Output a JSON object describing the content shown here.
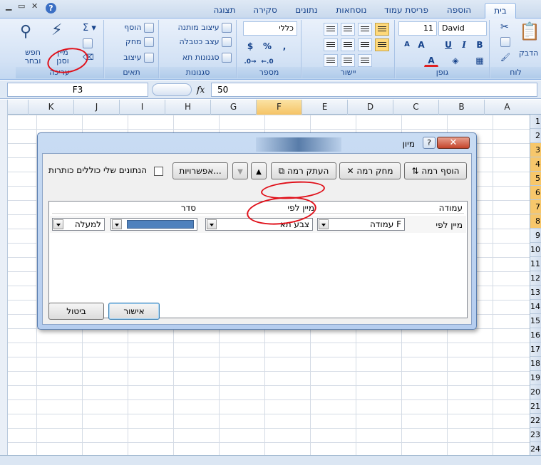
{
  "ribbon_tabs": [
    "בית",
    "הוספה",
    "פריסת עמוד",
    "נוסחאות",
    "נתונים",
    "סקירה",
    "תצוגה"
  ],
  "ribbon": {
    "clipboard": {
      "label": "לוח",
      "paste": "הדבק"
    },
    "font": {
      "label": "גופן",
      "name": "David",
      "size": "11"
    },
    "alignment": {
      "label": "יישור"
    },
    "number": {
      "label": "מספר",
      "format": "כללי",
      "percent": "%"
    },
    "styles": {
      "label": "סגנונות",
      "conditional": "עיצוב מותנה",
      "as_table": "עצב כטבלה",
      "cell_styles": "סגנונות תא"
    },
    "cells": {
      "label": "תאים",
      "insert": "הוסף",
      "delete": "מחק",
      "format": "עיצוב"
    },
    "editing": {
      "label": "עריכה",
      "sort_filter": "מיין\nוסנן",
      "find_select": "חפש\nובחר"
    }
  },
  "formula_bar": {
    "name_box": "F3",
    "fx": "fx",
    "value": "50"
  },
  "columns": [
    "A",
    "B",
    "C",
    "D",
    "E",
    "F",
    "G",
    "H",
    "I",
    "J",
    "K"
  ],
  "selected_column": "F",
  "rows": [
    "1",
    "2",
    "3",
    "4",
    "5",
    "6",
    "7",
    "8",
    "9",
    "10",
    "11",
    "12",
    "13",
    "14",
    "15",
    "16",
    "17",
    "18",
    "19",
    "20",
    "21",
    "22",
    "23",
    "24"
  ],
  "dialog": {
    "title": "מיון",
    "add_level": "הוסף רמה",
    "delete_level": "מחק רמה",
    "copy_level": "העתק רמה",
    "options": "אפשרויות...",
    "has_headers": "הנתונים שלי כוללים כותרות",
    "headers": {
      "column": "עמודה",
      "sort_on": "מיין לפי",
      "order": "סדר"
    },
    "row": {
      "label": "מיין לפי",
      "column": "עמודה F",
      "sort_on": "צבע תא",
      "order_color": "#4f81bd",
      "position": "למעלה"
    },
    "ok": "אישור",
    "cancel": "ביטול"
  }
}
